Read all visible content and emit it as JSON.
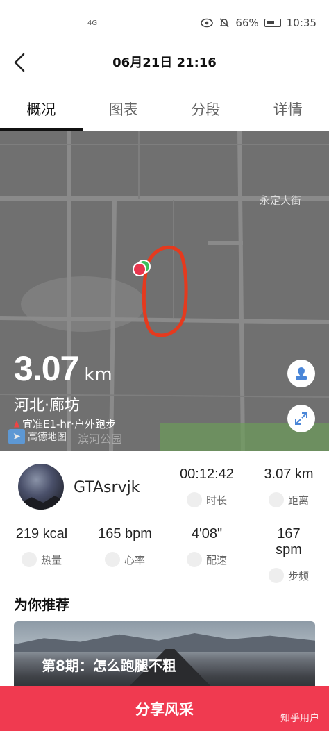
{
  "status_bar": {
    "signal": "4G",
    "battery": "66%",
    "time": "10:35",
    "icons": [
      "eye-icon",
      "bell-off-icon",
      "battery-icon"
    ]
  },
  "header": {
    "title": "06月21日 21:16"
  },
  "tabs": [
    {
      "label": "概况",
      "active": true
    },
    {
      "label": "图表",
      "active": false
    },
    {
      "label": "分段",
      "active": false
    },
    {
      "label": "详情",
      "active": false
    }
  ],
  "map": {
    "road_label": "永定大街",
    "distance_value": "3.07",
    "distance_unit": "km",
    "region": "河北·廊坊",
    "device": "宜准E1-hr·户外跑步",
    "map_provider": "高德地图",
    "park_label": "滨河公园",
    "route_color": "#e53a1e"
  },
  "user": {
    "name": "GTAsrvjk"
  },
  "stats_row1": [
    {
      "value": "00:12:42",
      "label": "时长",
      "icon": "clock-icon"
    },
    {
      "value": "3.07 km",
      "label": "距离",
      "icon": "shoe-icon"
    }
  ],
  "stats_row2": [
    {
      "value": "219 kcal",
      "label": "热量",
      "icon": "flame-icon"
    },
    {
      "value": "165 bpm",
      "label": "心率",
      "icon": "heart-icon"
    },
    {
      "value": "4'08\"",
      "label": "配速",
      "icon": "speedometer-icon"
    },
    {
      "value": "167 spm",
      "label": "步频",
      "icon": "footprints-icon"
    }
  ],
  "recommend": {
    "title": "为你推荐",
    "card_text": "第8期：怎么跑腿不粗"
  },
  "share": {
    "label": "分享风采"
  },
  "watermark": "知乎用户",
  "colors": {
    "accent": "#f03a50",
    "route": "#e53a1e"
  }
}
